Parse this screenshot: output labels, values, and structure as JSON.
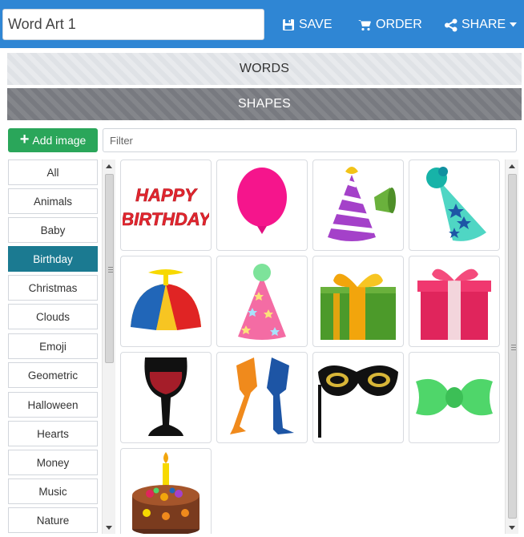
{
  "header": {
    "title_value": "Word Art 1",
    "save_label": "SAVE",
    "order_label": "ORDER",
    "share_label": "SHARE"
  },
  "sections": {
    "words_label": "WORDS",
    "shapes_label": "SHAPES"
  },
  "toolbar": {
    "add_image_label": "Add image",
    "filter_placeholder": "Filter"
  },
  "categories": [
    {
      "label": "All"
    },
    {
      "label": "Animals"
    },
    {
      "label": "Baby"
    },
    {
      "label": "Birthday"
    },
    {
      "label": "Christmas"
    },
    {
      "label": "Clouds"
    },
    {
      "label": "Emoji"
    },
    {
      "label": "Geometric"
    },
    {
      "label": "Halloween"
    },
    {
      "label": "Hearts"
    },
    {
      "label": "Money"
    },
    {
      "label": "Music"
    },
    {
      "label": "Nature"
    }
  ],
  "active_category": "Birthday",
  "shapes": [
    {
      "icon": "happy-birthday-text-icon",
      "text_line1": "HAPPY",
      "text_line2": "BIRTHDAY"
    },
    {
      "icon": "balloon-icon"
    },
    {
      "icon": "party-hat-horn-icon"
    },
    {
      "icon": "party-hat-stars-icon"
    },
    {
      "icon": "propeller-cap-icon"
    },
    {
      "icon": "pink-party-hat-icon"
    },
    {
      "icon": "green-gift-box-icon"
    },
    {
      "icon": "pink-gift-box-icon"
    },
    {
      "icon": "wine-glass-icon"
    },
    {
      "icon": "champagne-glasses-icon"
    },
    {
      "icon": "masquerade-mask-icon"
    },
    {
      "icon": "bow-tie-icon"
    },
    {
      "icon": "birthday-cake-icon"
    }
  ],
  "colors": {
    "header_bg": "#2f86d4",
    "active_category_bg": "#1b7a91",
    "add_button_bg": "#2aa65a",
    "shapes_header_bg": "#7d7f84"
  }
}
